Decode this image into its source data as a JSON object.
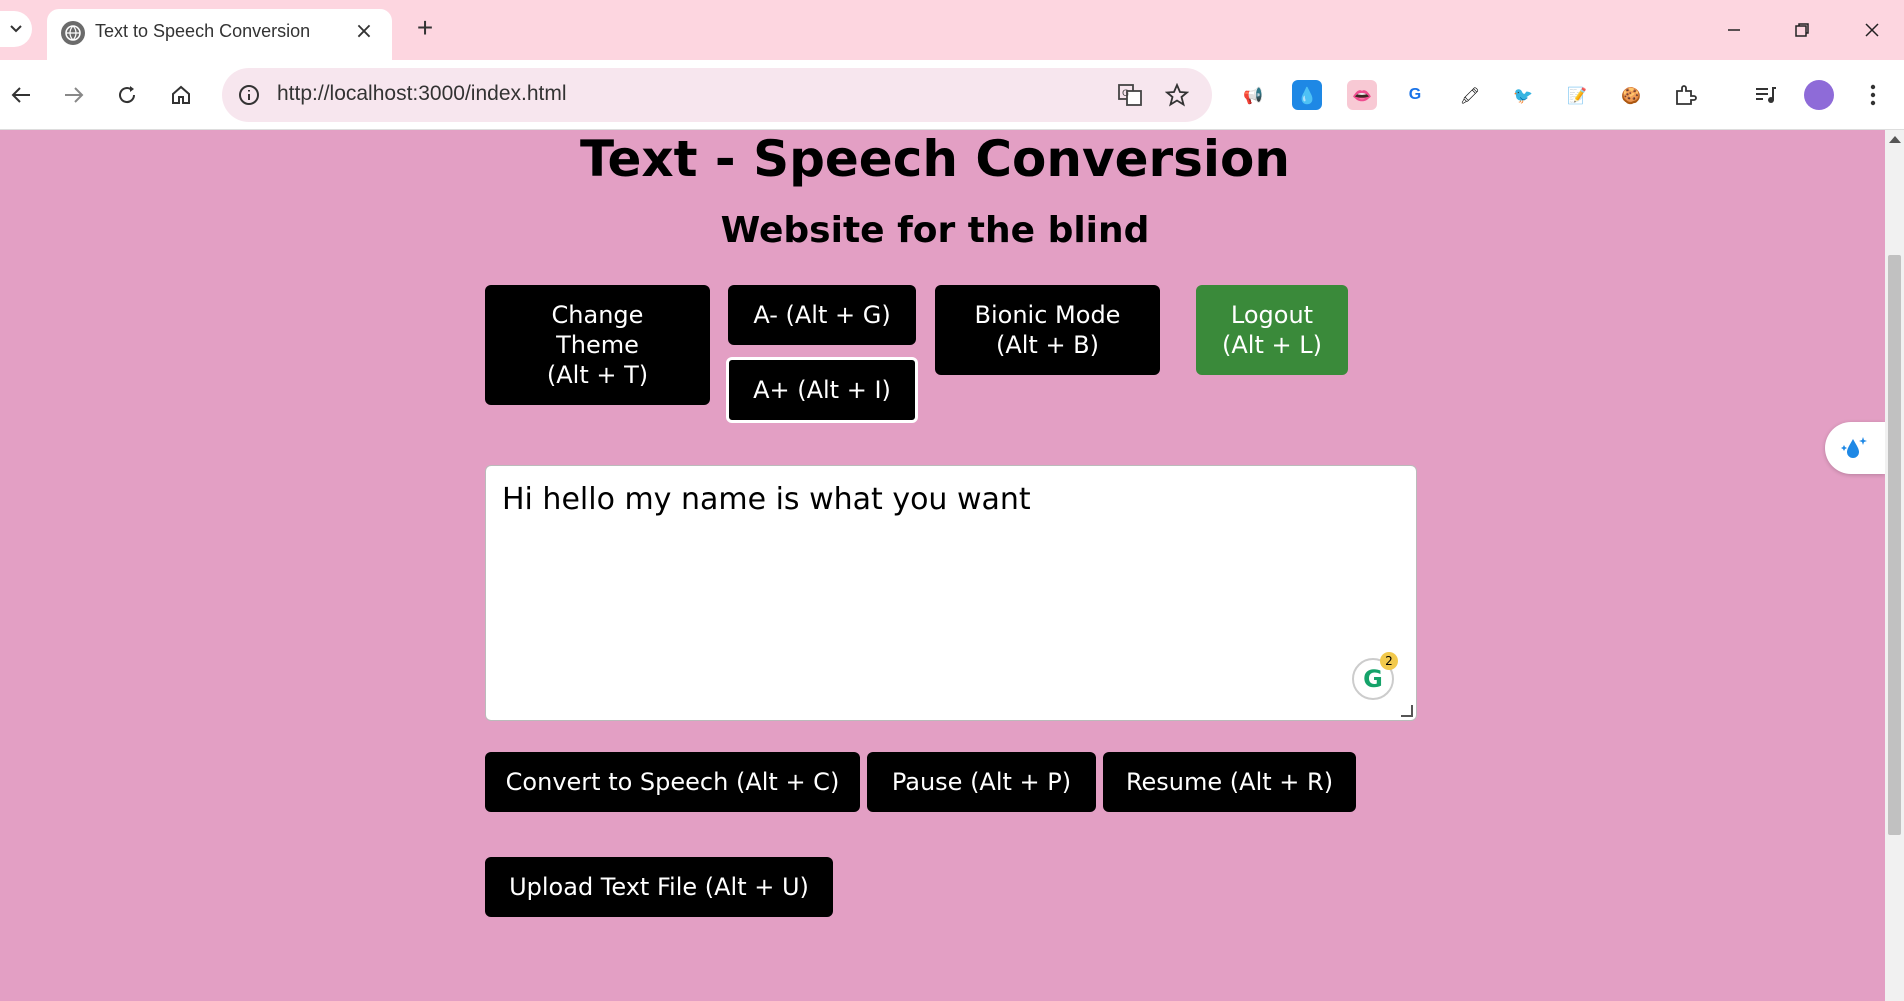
{
  "browser": {
    "tab_title": "Text to Speech Conversion",
    "url": "http://localhost:3000/index.html"
  },
  "page": {
    "title": "Text - Speech Conversion",
    "subtitle": "Website for the blind",
    "buttons": {
      "change_theme": [
        "Change",
        "Theme",
        "(Alt + T)"
      ],
      "font_decrease": "A- (Alt + G)",
      "font_increase": "A+ (Alt + I)",
      "bionic_mode": [
        "Bionic Mode",
        "(Alt + B)"
      ],
      "logout": [
        "Logout",
        "(Alt + L)"
      ],
      "convert": "Convert to Speech (Alt + C)",
      "pause": "Pause (Alt + P)",
      "resume": "Resume (Alt + R)",
      "upload": "Upload Text File (Alt + U)"
    },
    "textarea_value": "Hi hello my name is what you want",
    "grammarly_count": "2"
  },
  "colors": {
    "page_background": "#e39fc4",
    "button_background": "#000000",
    "logout_background": "#3a8a3a",
    "tabbar_background": "#fdd6e0"
  }
}
